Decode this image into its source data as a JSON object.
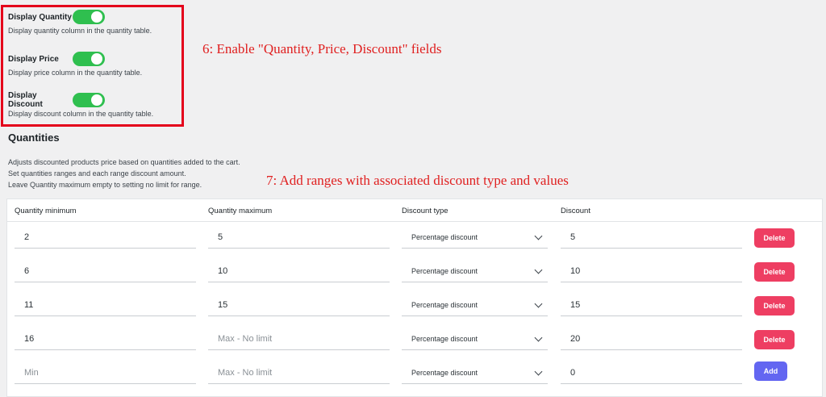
{
  "settings": [
    {
      "label": "Display Quantity",
      "description": "Display quantity column in the quantity table.",
      "enabled": true
    },
    {
      "label": "Display Price",
      "description": "Display price column in the quantity table.",
      "enabled": true
    },
    {
      "label": "Display Discount",
      "description": "Display discount column in the quantity table.",
      "enabled": true
    }
  ],
  "annotations": {
    "step6": "6: Enable \"Quantity, Price, Discount\" fields",
    "step7": "7: Add ranges with associated discount type and values"
  },
  "quantities": {
    "title": "Quantities",
    "description_lines": [
      "Adjusts discounted products price based on quantities added to the cart.",
      "Set quantities ranges and each range discount amount.",
      "Leave Quantity maximum empty to setting no limit for range."
    ],
    "headers": {
      "min": "Quantity minimum",
      "max": "Quantity maximum",
      "type": "Discount type",
      "discount": "Discount"
    },
    "rows": [
      {
        "min": "2",
        "max": "5",
        "type": "Percentage discount",
        "discount": "5",
        "action": "Delete"
      },
      {
        "min": "6",
        "max": "10",
        "type": "Percentage discount",
        "discount": "10",
        "action": "Delete"
      },
      {
        "min": "11",
        "max": "15",
        "type": "Percentage discount",
        "discount": "15",
        "action": "Delete"
      },
      {
        "min": "16",
        "max_placeholder": "Max - No limit",
        "type": "Percentage discount",
        "discount": "20",
        "action": "Delete"
      }
    ],
    "new_row": {
      "min_placeholder": "Min",
      "max_placeholder": "Max - No limit",
      "type": "Percentage discount",
      "discount": "0",
      "action": "Add"
    }
  },
  "colors": {
    "toggle_on": "#2fbf4f",
    "delete_button": "#ee3e62",
    "add_button": "#6366f1",
    "annotation": "#e02020",
    "highlight_border": "#e4001b"
  },
  "icons": {
    "select_arrow": "chevron-down-icon"
  }
}
